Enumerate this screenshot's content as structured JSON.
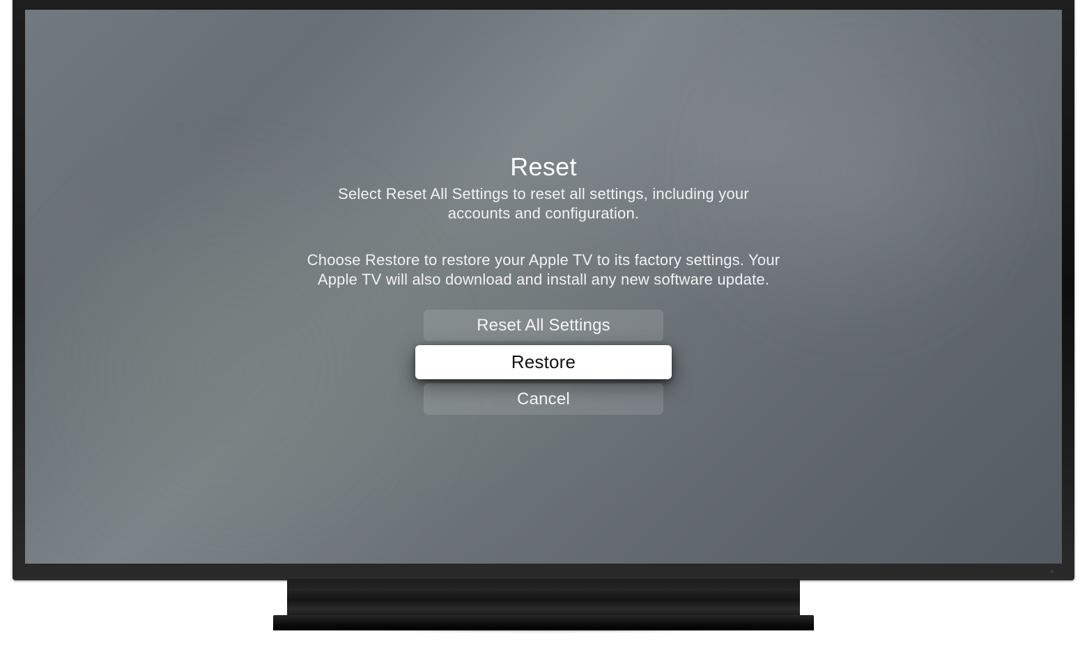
{
  "dialog": {
    "title": "Reset",
    "paragraph1": "Select Reset All Settings to reset all settings, including your accounts and configuration.",
    "paragraph2": "Choose Restore to restore your Apple TV to its factory settings. Your Apple TV will also download and install any new software update.",
    "options": {
      "reset_all": "Reset All Settings",
      "restore": "Restore",
      "cancel": "Cancel"
    },
    "selected_option": "restore"
  }
}
